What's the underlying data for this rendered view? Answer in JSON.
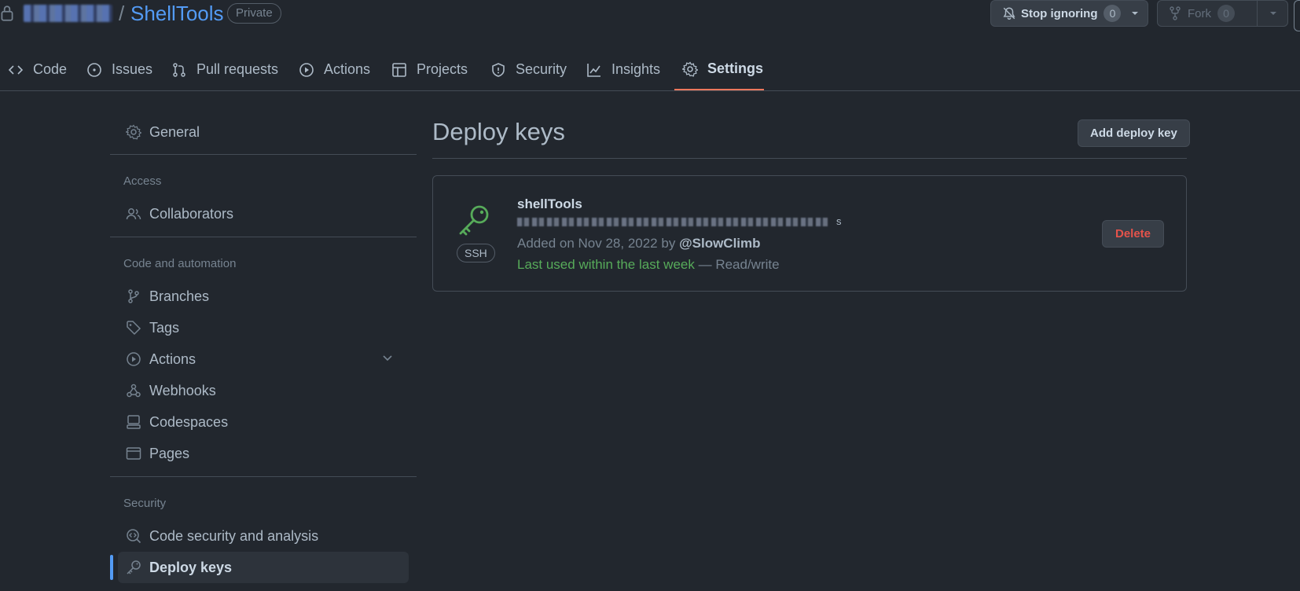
{
  "repo": {
    "name": "ShellTools",
    "slash": "/",
    "visibility": "Private"
  },
  "header_actions": {
    "watch_label": "Stop ignoring",
    "watch_count": "0",
    "fork_label": "Fork",
    "fork_count": "0"
  },
  "tabs": [
    {
      "label": "Code",
      "icon": "code-icon"
    },
    {
      "label": "Issues",
      "icon": "issue-icon"
    },
    {
      "label": "Pull requests",
      "icon": "pull-request-icon"
    },
    {
      "label": "Actions",
      "icon": "play-icon"
    },
    {
      "label": "Projects",
      "icon": "table-icon"
    },
    {
      "label": "Security",
      "icon": "shield-icon"
    },
    {
      "label": "Insights",
      "icon": "graph-icon"
    },
    {
      "label": "Settings",
      "icon": "gear-icon",
      "selected": true
    }
  ],
  "sidebar": {
    "general": "General",
    "access_heading": "Access",
    "collaborators": "Collaborators",
    "code_automation_heading": "Code and automation",
    "branches": "Branches",
    "tags": "Tags",
    "actions": "Actions",
    "webhooks": "Webhooks",
    "codespaces": "Codespaces",
    "pages": "Pages",
    "security_heading": "Security",
    "code_security": "Code security and analysis",
    "deploy_keys": "Deploy keys"
  },
  "main": {
    "title": "Deploy keys",
    "add_button": "Add deploy key",
    "key": {
      "title": "shellTools",
      "type_badge": "SSH",
      "fingerprint_tail": "s",
      "added_prefix": "Added on Nov 28, 2022 by",
      "added_user": "@SlowClimb",
      "last_used": "Last used within the last week",
      "access": "— Read/write",
      "delete_button": "Delete"
    }
  },
  "colors": {
    "background": "#22272e",
    "accent_link": "#539bf5",
    "tab_underline": "#ec775c",
    "success": "#57ab5a",
    "danger": "#e5534b"
  }
}
